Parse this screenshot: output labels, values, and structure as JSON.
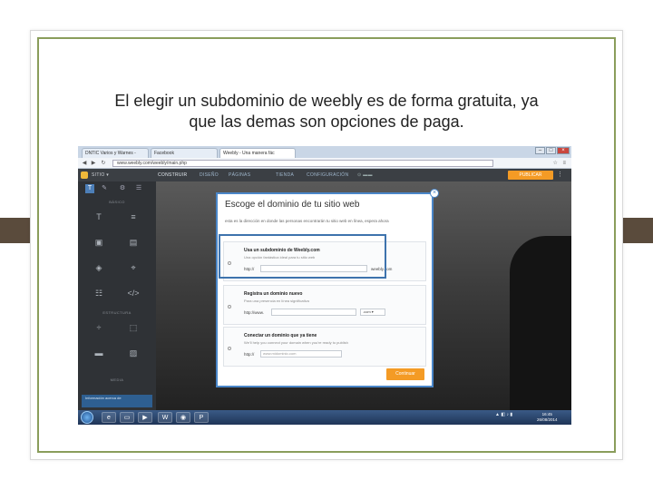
{
  "slide": {
    "caption_line1": "El elegir un subdominio de weebly es de forma gratuita, ya",
    "caption_line2": "que las demas son opciones de paga.",
    "accent_color": "#8a9d5b",
    "tab_color": "#5a4b3c"
  },
  "browser": {
    "tabs": [
      {
        "label": "DNTIC Varios y Warnes -"
      },
      {
        "label": "Facebook"
      },
      {
        "label": "Weebly - Una manera fác"
      }
    ],
    "url": "www.weebly.com/weebly/main.php",
    "window_controls": [
      "–",
      "□",
      "×"
    ]
  },
  "weebly": {
    "site_name": "SITIO ▾",
    "nav": [
      "CONSTRUIR",
      "DISEÑO",
      "PÁGINAS",
      "TIENDA",
      "CONFIGURACIÓN"
    ],
    "publish_label": "PUBLICAR",
    "sidebar": {
      "section_basic": "BÁSICO",
      "section_structure": "ESTRUCTURA",
      "section_media": "MEDIA",
      "info_label": "Información acerca de"
    }
  },
  "dialog": {
    "title": "Escoge el dominio de tu sitio web",
    "description": "esta es la dirección en donde las personas encontrarán tu sitio web en línea, espera ahora",
    "options": [
      {
        "title": "Usa un subdominio de Weebly.com",
        "subtitle": "Una opción fantástica ideal para tu sitio web",
        "prefix": "http://",
        "input_value": "",
        "suffix": "weebly.com"
      },
      {
        "title": "Registra un dominio nuevo",
        "subtitle": "Para una presencia en línea significativa",
        "prefix": "http://www.",
        "input_value": "",
        "select_value": ".com"
      },
      {
        "title": "Conectar un dominio que ya tiene",
        "subtitle": "We'll help you connect your domain when you're ready to publish",
        "prefix": "http://",
        "input_value": "www.midominio.com"
      }
    ],
    "continue_label": "Continuar",
    "close_label": "×"
  },
  "taskbar": {
    "clock_time": "16:45",
    "clock_date": "26/08/2014"
  }
}
